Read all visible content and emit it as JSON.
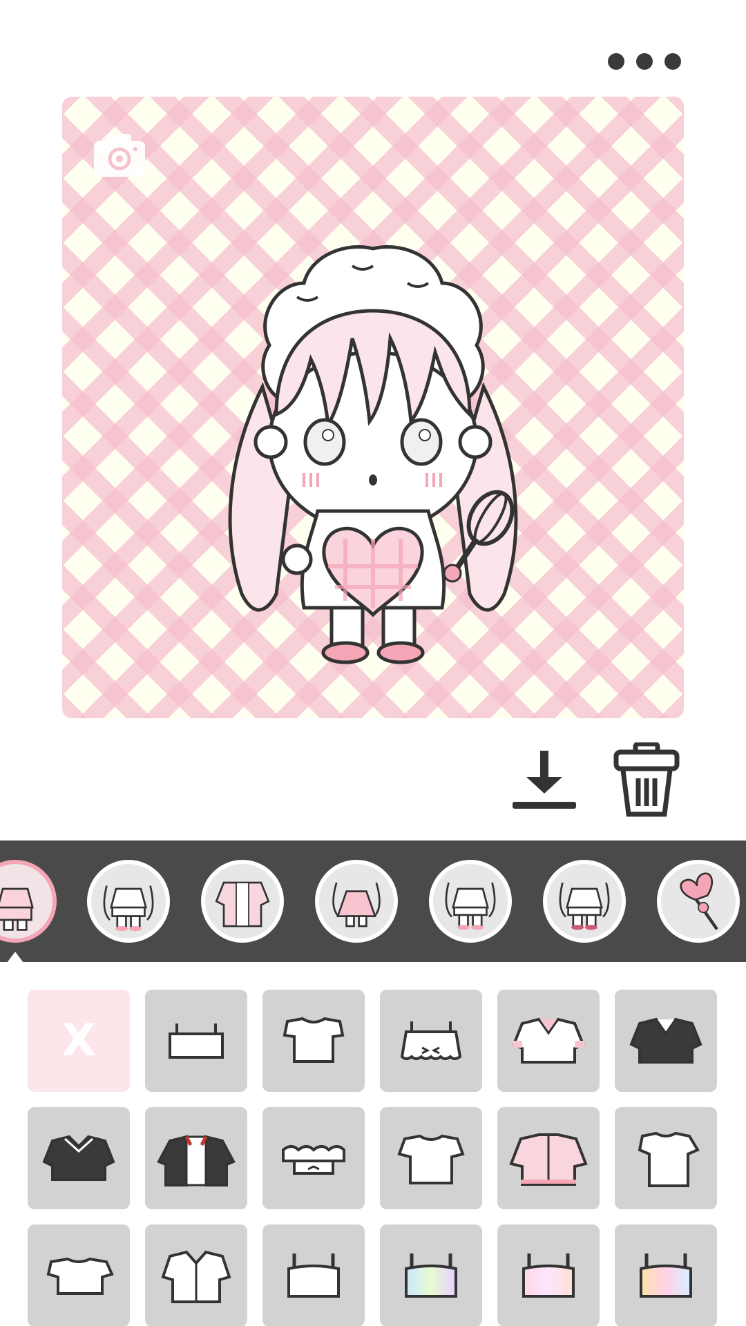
{
  "header": {
    "more_icon": "more-horizontal-icon"
  },
  "canvas": {
    "background_pattern": "pink-gingham",
    "colors": {
      "gingham_pink": "#f6becd",
      "gingham_cream": "#fffff0",
      "hair": "#fbe4ea",
      "outline": "#333333",
      "accent": "#f4a5b6"
    },
    "camera_icon": "camera-icon"
  },
  "actions": {
    "download_icon": "download-icon",
    "trash_icon": "trash-icon"
  },
  "categories": [
    {
      "name": "outfit-1",
      "selected": true
    },
    {
      "name": "outfit-2"
    },
    {
      "name": "cardigan"
    },
    {
      "name": "pink-dress"
    },
    {
      "name": "outfit-5"
    },
    {
      "name": "outfit-6"
    },
    {
      "name": "heart-wand"
    }
  ],
  "items": {
    "none_label": "X",
    "list": [
      "none",
      "crop-cami",
      "tee-crop",
      "frill-cami",
      "pink-sailor",
      "black-sailor",
      "black-sailor-2",
      "open-jacket",
      "off-shoulder",
      "white-tee",
      "pink-zip-jacket",
      "white-tee-2",
      "crop-tee",
      "shirt",
      "white-tank",
      "holo-tank",
      "pastel-tank",
      "rainbow-tank"
    ]
  }
}
